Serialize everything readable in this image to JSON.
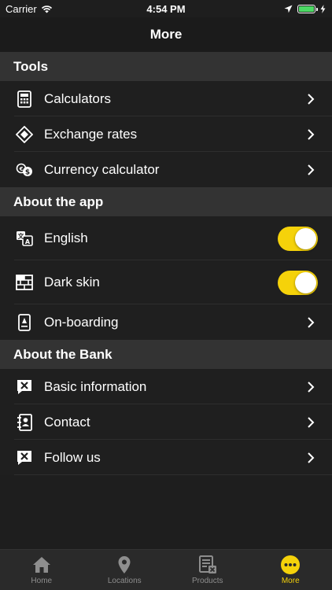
{
  "status": {
    "carrier": "Carrier",
    "time": "4:54 PM"
  },
  "nav": {
    "title": "More"
  },
  "sections": [
    {
      "title": "Tools",
      "items": [
        {
          "label": "Calculators",
          "icon": "calculator-icon"
        },
        {
          "label": "Exchange rates",
          "icon": "exchange-icon"
        },
        {
          "label": "Currency calculator",
          "icon": "coins-icon"
        }
      ]
    },
    {
      "title": "About the app",
      "items": [
        {
          "label": "English",
          "icon": "translate-icon",
          "toggle": true
        },
        {
          "label": "Dark skin",
          "icon": "brick-icon",
          "toggle": true
        },
        {
          "label": "On-boarding",
          "icon": "phone-icon"
        }
      ]
    },
    {
      "title": "About the Bank",
      "items": [
        {
          "label": "Basic information",
          "icon": "chat-x-icon"
        },
        {
          "label": "Contact",
          "icon": "contact-book-icon"
        },
        {
          "label": "Follow us",
          "icon": "chat-x-icon"
        }
      ]
    }
  ],
  "tabs": [
    {
      "label": "Home",
      "icon": "home-icon"
    },
    {
      "label": "Locations",
      "icon": "pin-icon"
    },
    {
      "label": "Products",
      "icon": "products-icon"
    },
    {
      "label": "More",
      "icon": "more-icon",
      "active": true
    }
  ],
  "colors": {
    "accent": "#f5d20a",
    "background": "#1e1e1e",
    "section": "#333333"
  }
}
